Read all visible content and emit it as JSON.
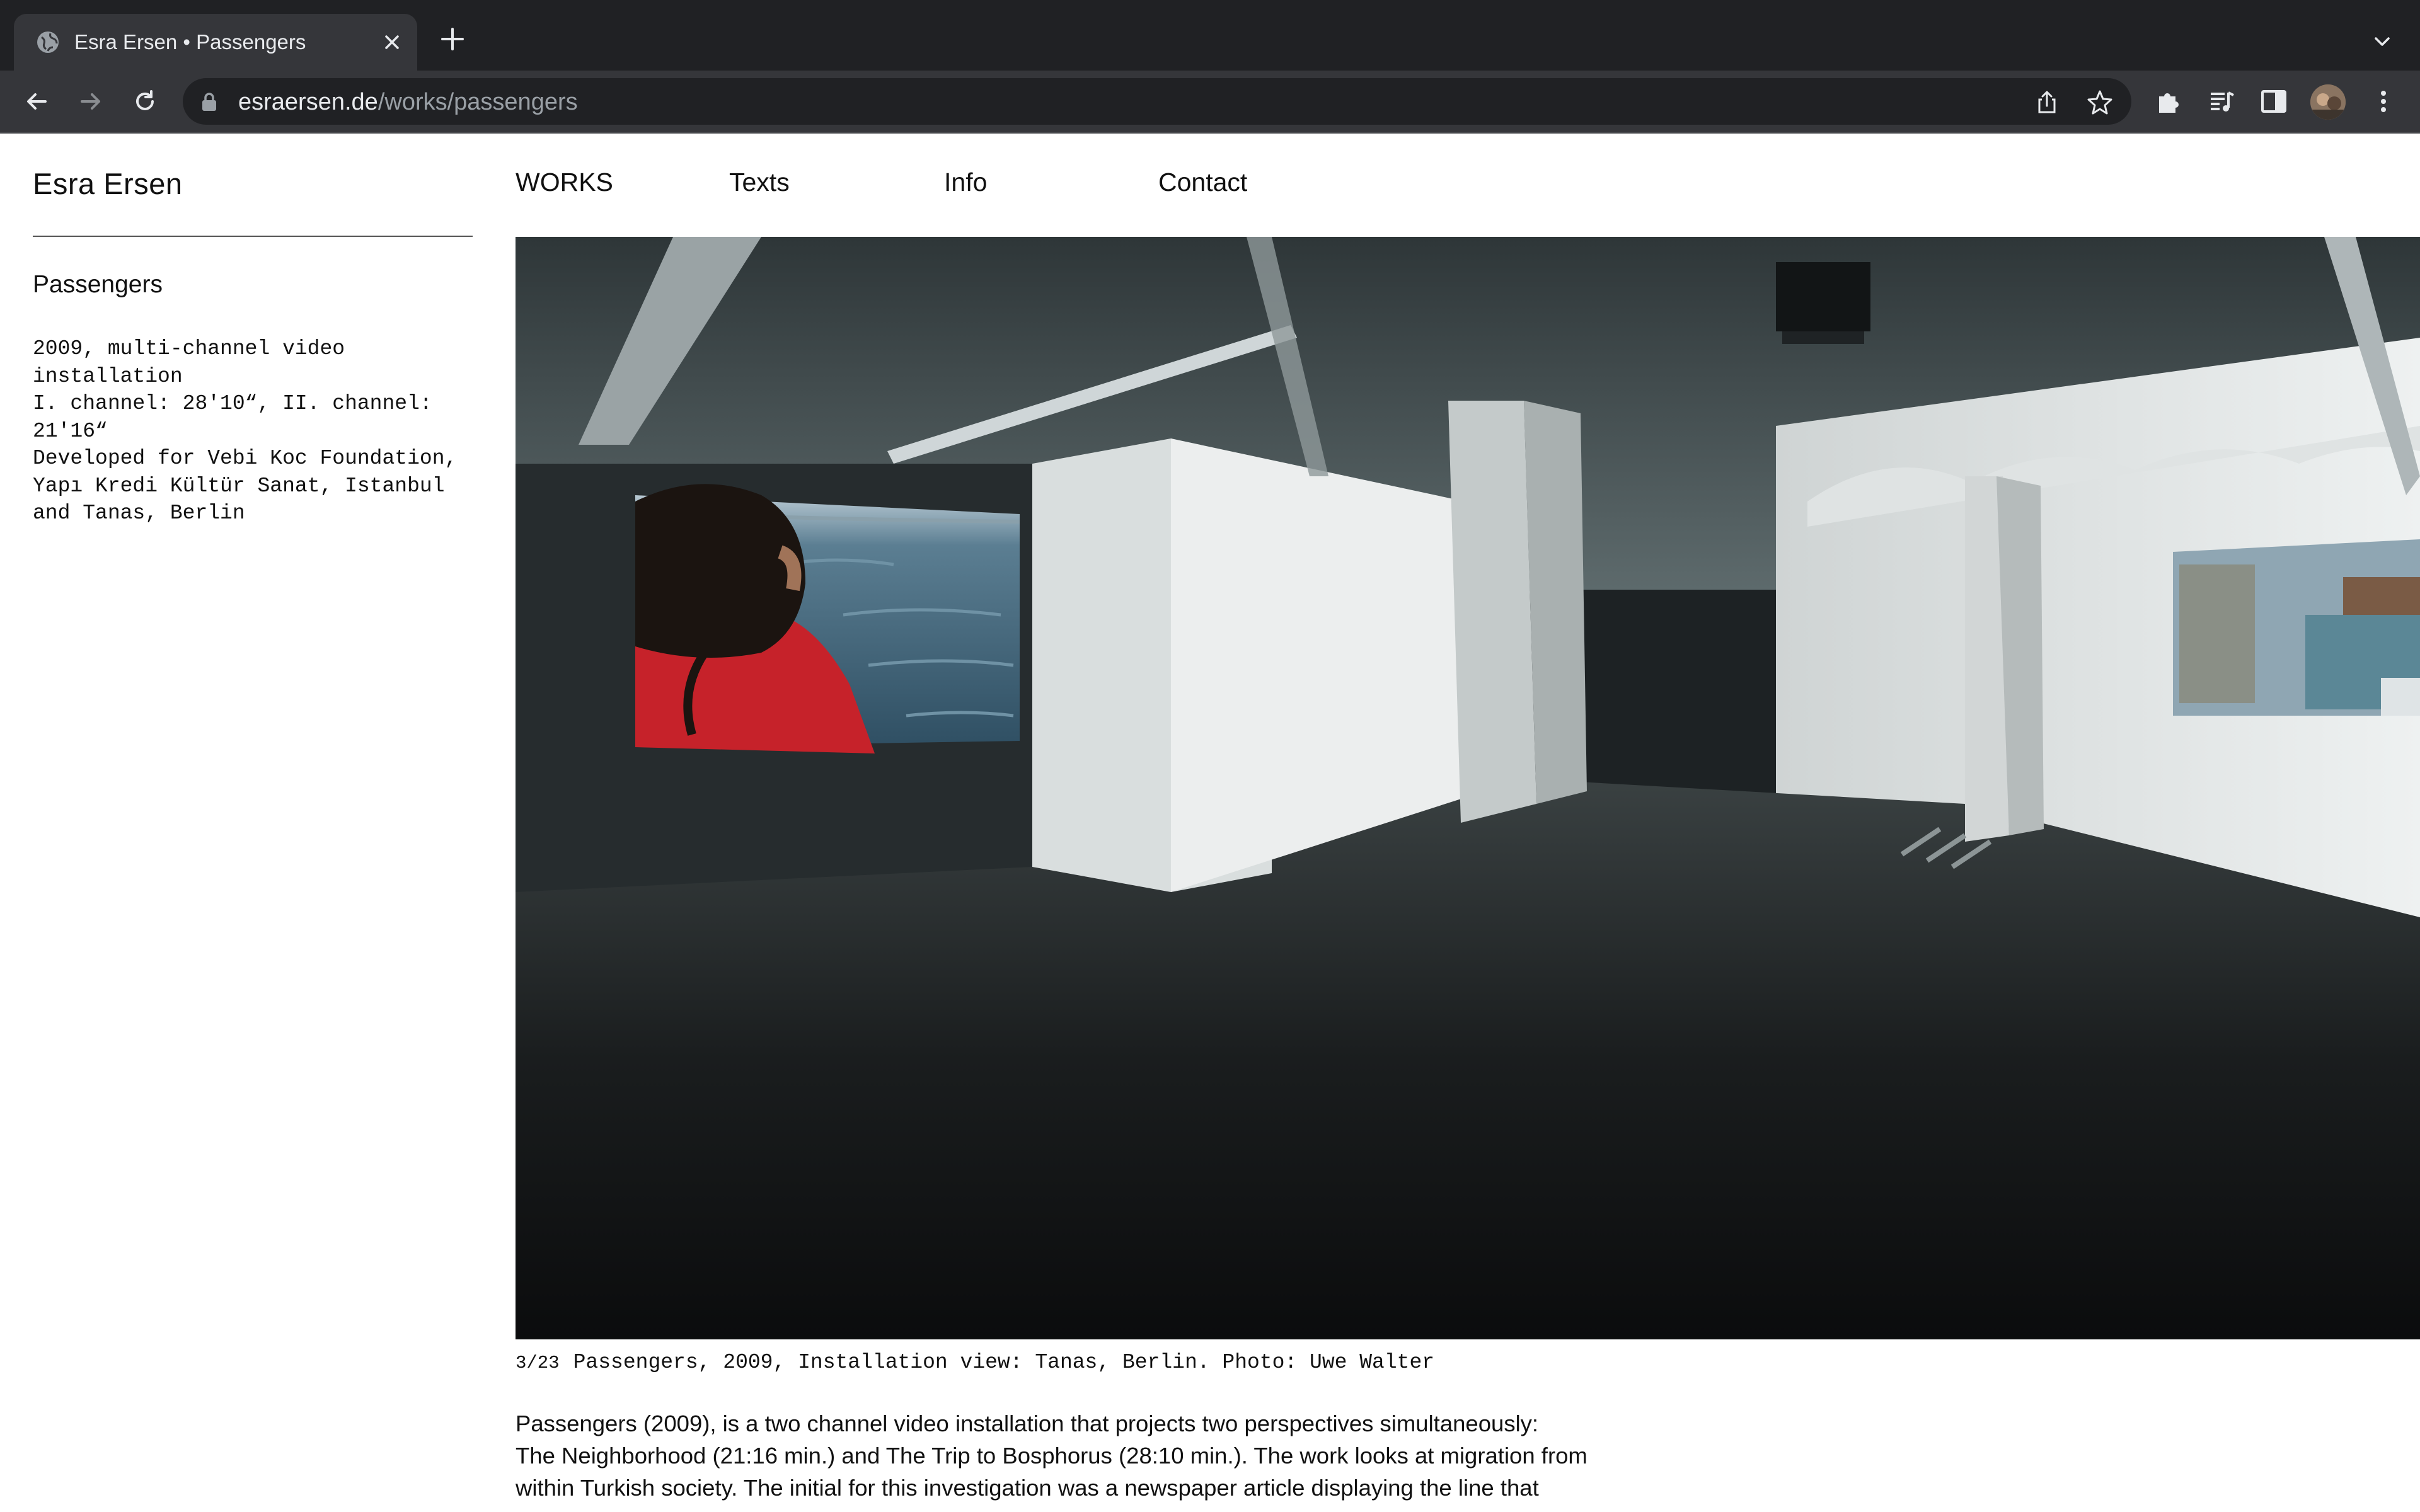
{
  "browser": {
    "tab_title": "Esra Ersen • Passengers",
    "url_host": "esraersen.de",
    "url_path": "/works/passengers"
  },
  "site": {
    "name": "Esra Ersen",
    "nav": [
      "WORKS",
      "Texts",
      "Info",
      "Contact"
    ]
  },
  "work": {
    "title": "Passengers",
    "details": [
      "2009, multi-channel video",
      "installation",
      "I. channel: 28'10“, II. channel:",
      "21'16“",
      "Developed for Vebi Koc Foundation,",
      "Yapı Kredi Kültür Sanat, Istanbul",
      "and Tanas, Berlin"
    ],
    "image_counter": "3/23",
    "caption": "Passengers, 2009, Installation view: Tanas, Berlin. Photo: Uwe Walter",
    "description": [
      "Passengers (2009), is a two channel video installation that projects two perspectives simultaneously:",
      "The Neighborhood (21:16 min.) and The Trip to Bosphorus (28:10 min.). The work looks at migration from",
      "within Turkish society. The initial for this investigation was a newspaper article displaying the line that"
    ]
  },
  "colors": {
    "chrome_dark": "#202124",
    "chrome_toolbar": "#35363a",
    "text": "#111111"
  },
  "icons": [
    "globe-icon",
    "close-icon",
    "plus-icon",
    "chevron-down-icon",
    "back-arrow-icon",
    "forward-arrow-icon",
    "reload-icon",
    "lock-icon",
    "share-icon",
    "star-icon",
    "puzzle-icon",
    "media-control-icon",
    "side-panel-icon",
    "avatar",
    "more-vert-icon"
  ]
}
